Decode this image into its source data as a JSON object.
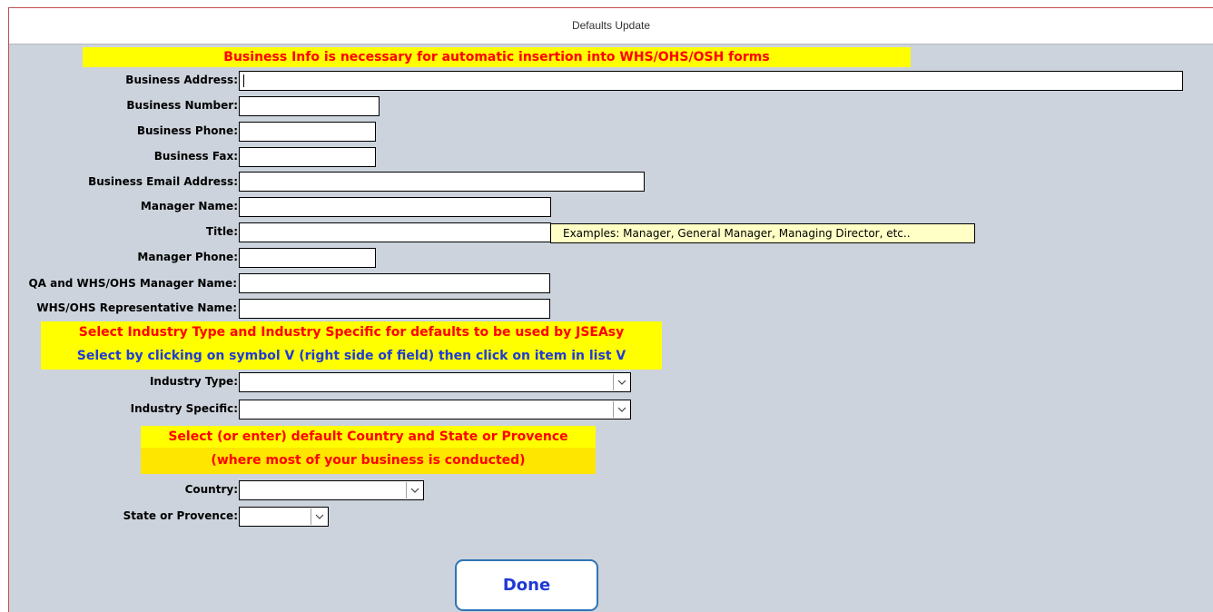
{
  "window": {
    "title": "Defaults Update"
  },
  "banners": {
    "business_info": "Business Info is necessary for automatic insertion into WHS/OHS/OSH forms",
    "industry_line1": "Select Industry Type and Industry Specific for defaults to be used by JSEAsy",
    "industry_line2": "Select by clicking on symbol V (right side of field) then click on item in list   V",
    "country_line1": "Select (or enter) default Country and State or Provence",
    "country_line2": "(where most of your business is conducted)"
  },
  "fields": {
    "business_address": {
      "label": "Business Address:",
      "value": ""
    },
    "business_number": {
      "label": "Business Number:",
      "value": ""
    },
    "business_phone": {
      "label": "Business Phone:",
      "value": ""
    },
    "business_fax": {
      "label": "Business Fax:",
      "value": ""
    },
    "business_email": {
      "label": "Business Email Address:",
      "value": ""
    },
    "manager_name": {
      "label": "Manager Name:",
      "value": ""
    },
    "title": {
      "label": "Title:",
      "value": ""
    },
    "manager_phone": {
      "label": "Manager Phone:",
      "value": ""
    },
    "qa_manager_name": {
      "label": "QA and WHS/OHS Manager Name:",
      "value": ""
    },
    "whs_rep_name": {
      "label": "WHS/OHS Representative Name:",
      "value": ""
    },
    "industry_type": {
      "label": "Industry Type:",
      "value": ""
    },
    "industry_specific": {
      "label": "Industry Specific:",
      "value": ""
    },
    "country": {
      "label": "Country:",
      "value": ""
    },
    "state": {
      "label": "State or Provence:",
      "value": ""
    }
  },
  "title_tooltip": "Examples:  Manager, General Manager, Managing Director, etc..",
  "done_label": "Done",
  "icons": {
    "dropdown": "chevron-down-icon"
  },
  "colors": {
    "form_bg": "#ccd3dc",
    "banner_bg": "#ffff00",
    "banner_text": "#ff0000",
    "accent_blue": "#1f3ad6"
  }
}
